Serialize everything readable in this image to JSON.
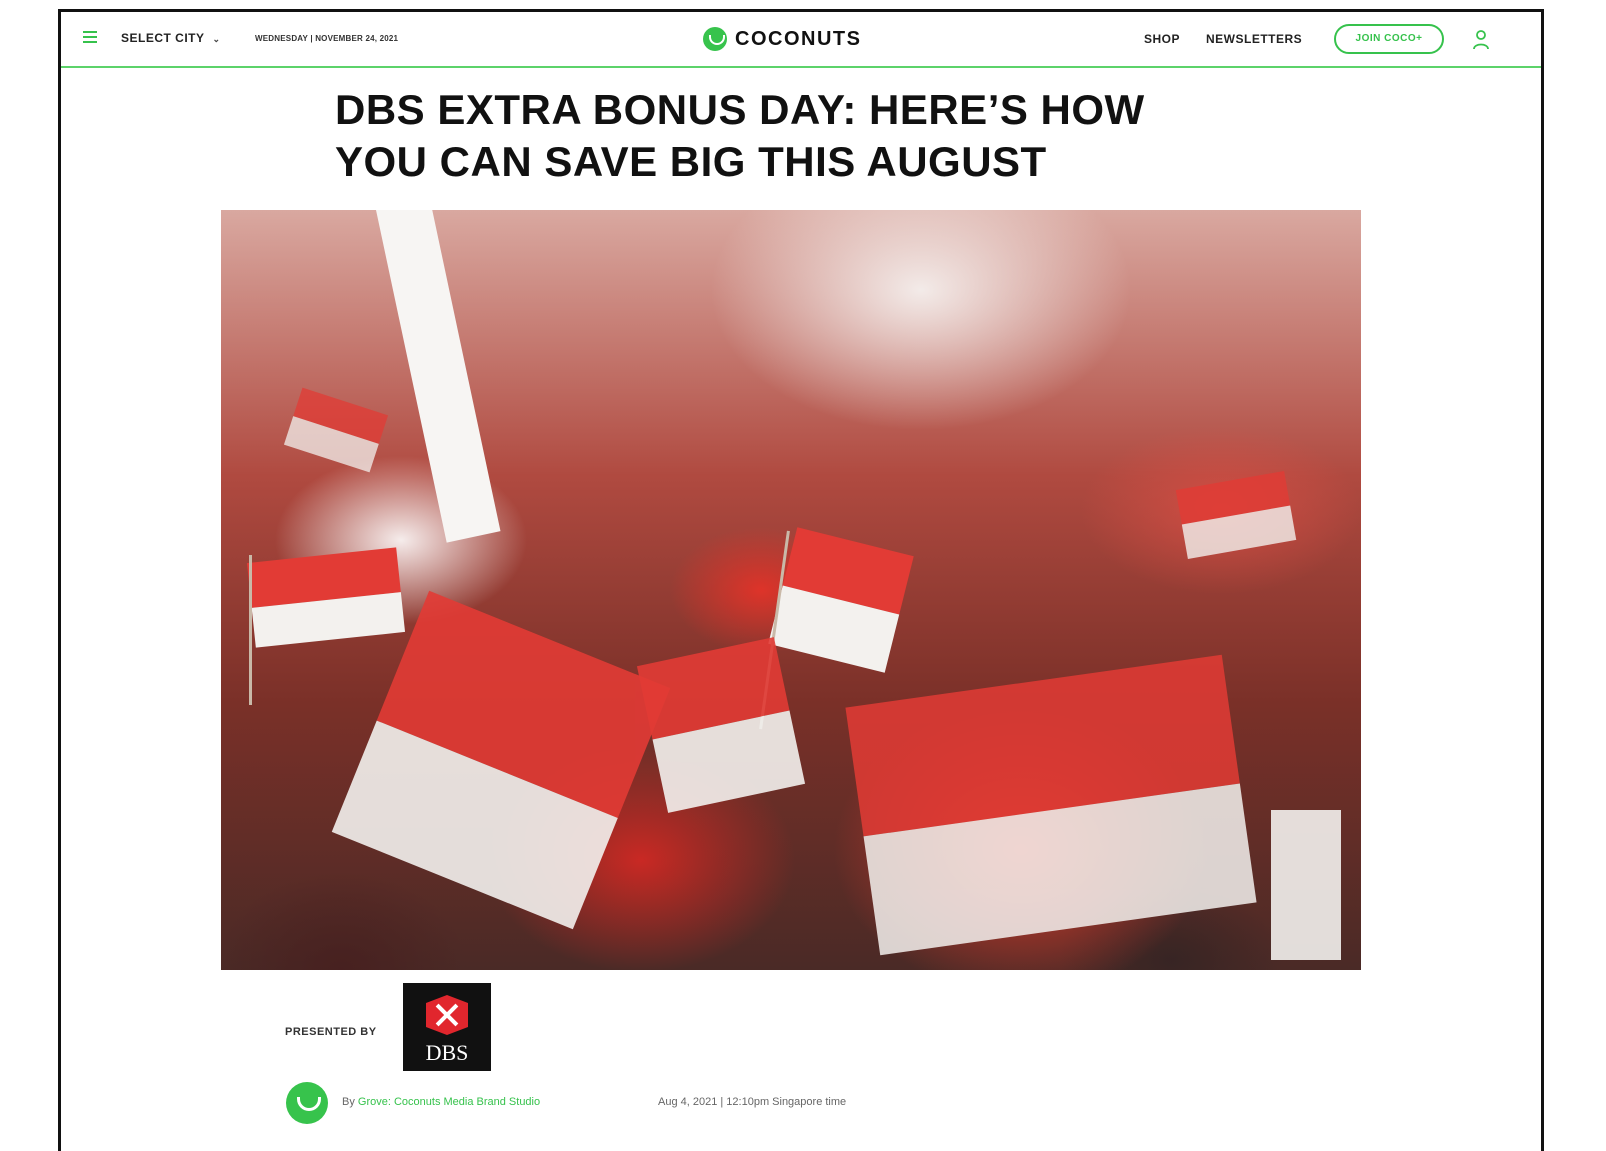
{
  "topbar": {
    "select_city": "SELECT CITY",
    "date": "WEDNESDAY | NOVEMBER 24, 2021",
    "logo_text": "COCONUTS",
    "nav_shop": "SHOP",
    "nav_newsletters": "NEWSLETTERS",
    "join_button": "JOIN COCO+",
    "icons": {
      "menu": "hamburger-menu-icon",
      "chevron": "chevron-down-icon",
      "logo": "coconut-logo-icon",
      "user": "user-icon"
    }
  },
  "article": {
    "headline": "DBS EXTRA BONUS DAY: HERE’S HOW YOU CAN SAVE BIG THIS AUGUST",
    "hero_image": "crowd-waving-singapore-flags-photo",
    "sponsor": {
      "presented_by": "PRESENTED BY",
      "logo_text": "DBS"
    },
    "byline": {
      "prefix": "By",
      "author": "Grove: Coconuts Media Brand Studio"
    },
    "timestamp": "Aug 4, 2021 | 12:10pm Singapore time"
  },
  "colors": {
    "brand_green": "#36c24c",
    "dbs_red": "#e1262d",
    "text": "#111111"
  }
}
